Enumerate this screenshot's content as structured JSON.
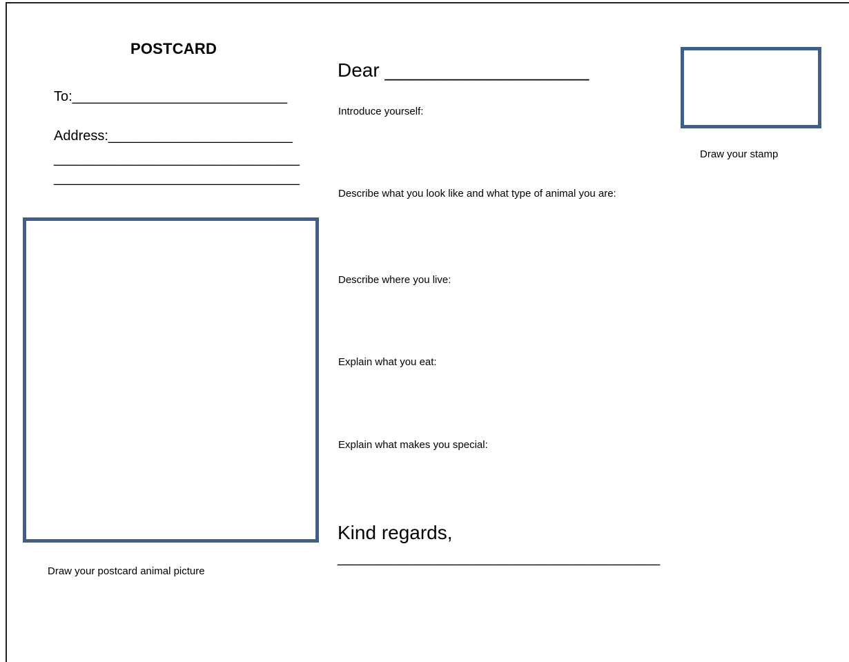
{
  "postcard": {
    "title": "POSTCARD",
    "to_line": "To:____________________________",
    "address_line": "Address:________________________",
    "address_blank_1": "________________________________",
    "address_blank_2": "________________________________",
    "picture_caption": "Draw your postcard animal picture"
  },
  "letter": {
    "greeting": "Dear ___________________",
    "prompts": [
      "Introduce yourself:",
      "Describe what you look like and what type of animal you are:",
      "Describe where you live:",
      "Explain what you eat:",
      "Explain what makes you special:"
    ],
    "closing": "Kind regards,",
    "signature_line": "__________________________________________"
  },
  "stamp": {
    "caption": "Draw your stamp"
  },
  "colors": {
    "frame_border": "#3e5f8a",
    "card_border": "#222222"
  }
}
